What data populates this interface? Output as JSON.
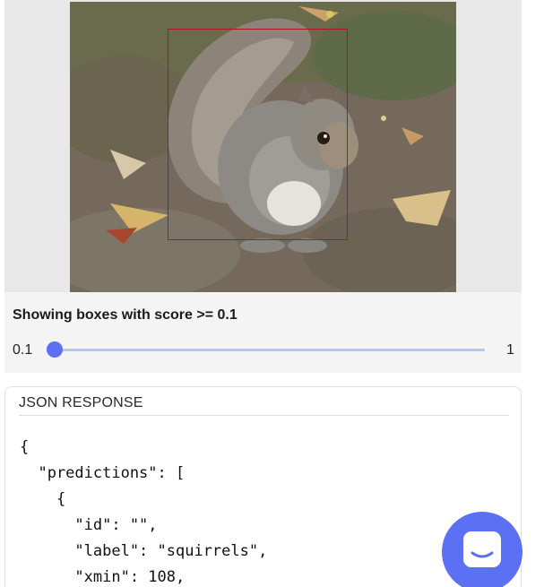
{
  "detection_image": {
    "box_label": "squirrels"
  },
  "score_filter": {
    "title": "Showing boxes with score >= 0.1",
    "min_label": "0.1",
    "max_label": "1",
    "value": 0.1,
    "accent_color": "#5b70f2"
  },
  "json_response": {
    "header": "JSON RESPONSE",
    "lines": [
      "{",
      "  \"predictions\": [",
      "    {",
      "      \"id\": \"\",",
      "      \"label\": \"squirrels\",",
      "      \"xmin\": 108,"
    ]
  },
  "chat_launcher": {
    "icon": "chat-bubble-icon",
    "color": "#5b70f2"
  }
}
